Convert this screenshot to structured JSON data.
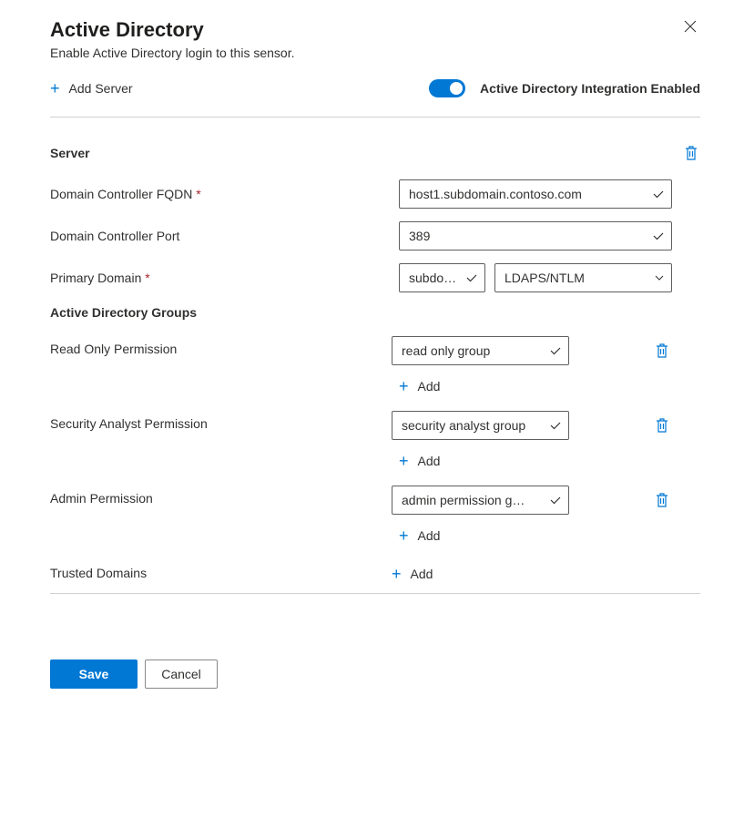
{
  "header": {
    "title": "Active Directory",
    "subtitle": "Enable Active Directory login to this sensor."
  },
  "topbar": {
    "add_server_label": "Add Server",
    "toggle_label": "Active Directory Integration Enabled",
    "toggle_on": true
  },
  "server": {
    "section_title": "Server",
    "fqdn_label": "Domain Controller FQDN",
    "fqdn_value": "host1.subdomain.contoso.com",
    "port_label": "Domain Controller Port",
    "port_value": "389",
    "primary_domain_label": "Primary Domain",
    "primary_domain_value": "subdo…",
    "auth_value": "LDAPS/NTLM"
  },
  "groups": {
    "heading": "Active Directory Groups",
    "read_only_label": "Read Only Permission",
    "read_only_value": "read only group",
    "analyst_label": "Security Analyst Permission",
    "analyst_value": "security analyst group",
    "admin_label": "Admin Permission",
    "admin_value": "admin permission g…",
    "trusted_label": "Trusted Domains",
    "add_label": "Add"
  },
  "footer": {
    "save_label": "Save",
    "cancel_label": "Cancel"
  },
  "colors": {
    "accent": "#0078d4",
    "danger": "#a4262c"
  }
}
